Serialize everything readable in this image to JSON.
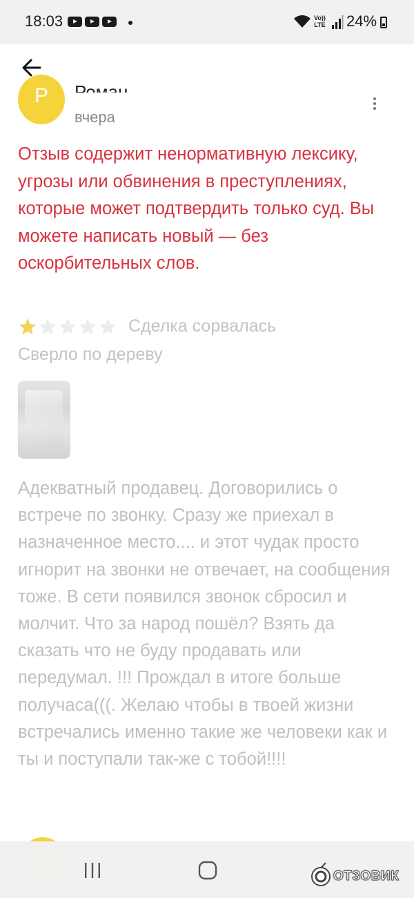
{
  "status_bar": {
    "time": "18:03",
    "battery": "24%",
    "network": "LTE",
    "volte_top": "Vo))",
    "volte_bottom": "LTE"
  },
  "header": {
    "back_icon": "arrow-left-icon"
  },
  "review": {
    "author": "Роман",
    "avatar_letter": "Р",
    "date": "вчера",
    "warning": "Отзыв содержит ненормативную лексику, угрозы или обвинения в преступлениях, которые может подтвердить только суд. Вы можете написать новый — без оскорбительных слов.",
    "rating": 1,
    "rating_max": 5,
    "status": "Сделка сорвалась",
    "product": "Сверло по дереву",
    "photos_count": 1,
    "body": "Адекватный продавец. Договорились о встрече по звонку. Сразу же приехал в назначенное место.... и этот чудак просто игнорит на звонки не отвечает, на сообщения тоже. В сети появился звонок сбросил и молчит. Что за народ пошёл? Взять да сказать что не буду продавать или передумал. !!! Прождал в итоге больше получаса(((. Желаю чтобы в твоей жизни встречались именно такие же человеки как и ты и поступали так-же с тобой!!!!"
  },
  "colors": {
    "warning": "#d8323f",
    "star_filled": "#f5d35a",
    "star_empty": "#ececec",
    "avatar": "#f5d33a",
    "muted_text": "#c0c0c0"
  },
  "watermark": {
    "text": "ОТЗОВИК"
  }
}
